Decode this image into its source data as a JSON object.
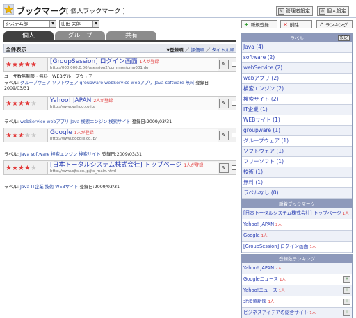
{
  "header": {
    "app_title": "ブックマーク",
    "page_subtitle": "[ 個人ブックマーク ]",
    "admin_settings_label": "管理者設定",
    "personal_settings_label": "個人設定"
  },
  "filters": {
    "group_select": "システム部",
    "user_select": "山田 太郎"
  },
  "tabs": [
    {
      "label": "個人",
      "active": true
    },
    {
      "label": "グループ",
      "active": false
    },
    {
      "label": "共有",
      "active": false
    }
  ],
  "list": {
    "header_title": "全件表示",
    "sort_current": "▼登録順",
    "sort_sep1": "／",
    "sort_rating": "評価順",
    "sort_sep2": "／",
    "sort_title": "タイトル順"
  },
  "bookmarks": [
    {
      "stars": 5,
      "title": "[GroupSession] ログイン画面",
      "badge": "1人が登録",
      "url": "http://000.000.0.00/gsession2/common/cmn001.do",
      "desc": "ユーザ数無制限・無料　WEBグループウェア",
      "label_prefix": "ラベル:",
      "tags": "グループウェア ソフトウェア groupware webService webアプリ Java software 無料",
      "date_label": "登録日",
      "date_value": "2009/03/31"
    },
    {
      "stars": 4,
      "title": "Yahoo! JAPAN",
      "badge": "2人が登録",
      "url": "http://www.yahoo.co.jp/",
      "desc": "",
      "label_prefix": "ラベル:",
      "tags": "webService webアプリ Java 検索エンジン 検索サイト",
      "date_label": "登録日",
      "date_value": "2009/03/31"
    },
    {
      "stars": 3,
      "title": "Google",
      "badge": "1人が登録",
      "url": "http://www.google.co.jp/",
      "desc": "",
      "label_prefix": "ラベル:",
      "tags": "Java software 検索エンジン 検索サイト",
      "date_label": "登録日",
      "date_value": "2009/03/31"
    },
    {
      "stars": 4,
      "title": "[日本トータルシステム株式会社] トップページ",
      "badge": "1人が登録",
      "url": "http://www.sjts.co.jp/jts_main.html",
      "desc": "",
      "label_prefix": "ラベル:",
      "tags": "Java IT企業 技術 WEBサイト",
      "date_label": "登録日",
      "date_value": "2009/03/31"
    }
  ],
  "actions": {
    "new_label": "新規登録",
    "delete_label": "削除",
    "ranking_label": "ランキング"
  },
  "labels_panel": {
    "title": "ラベル",
    "config_label": "設定",
    "items": [
      "Java (4)",
      "software (2)",
      "webService (2)",
      "webアプリ (2)",
      "検索エンジン (2)",
      "検索サイト (2)",
      "IT企業 (1)",
      "WEBサイト (1)",
      "groupware (1)",
      "グループウェア (1)",
      "ソフトウェア (1)",
      "フリーソフト (1)",
      "技術 (1)",
      "無料 (1)",
      "ラベルなし (0)"
    ]
  },
  "new_panel": {
    "title": "新着ブックマーク",
    "items": [
      {
        "text": "[日本トータルシステム株式会社] トップページ",
        "badge": "1人"
      },
      {
        "text": "Yahoo! JAPAN",
        "badge": "2人"
      },
      {
        "text": "Google",
        "badge": "1人"
      },
      {
        "text": "[GroupSession] ログイン画面",
        "badge": "1人"
      }
    ]
  },
  "ranking_panel": {
    "title": "登録数ランキング",
    "items": [
      {
        "text": "Yahoo! JAPAN",
        "badge": "2人",
        "icon": false
      },
      {
        "text": "Googleニュース",
        "badge": "1人",
        "icon": true
      },
      {
        "text": "Yahoo!ニュース",
        "badge": "1人",
        "icon": true
      },
      {
        "text": "北海道新聞",
        "badge": "1人",
        "icon": true
      },
      {
        "text": "ビジネスアイデアの総合サイト",
        "badge": "1人",
        "icon": true
      }
    ]
  },
  "colors": {
    "star_on": "#e23b3b",
    "star_off": "#c8c8c8",
    "link": "#2a3fb4",
    "panel_head": "#8e99bb",
    "tab_active": "#414141",
    "tab_inactive": "#8c8c8c"
  }
}
